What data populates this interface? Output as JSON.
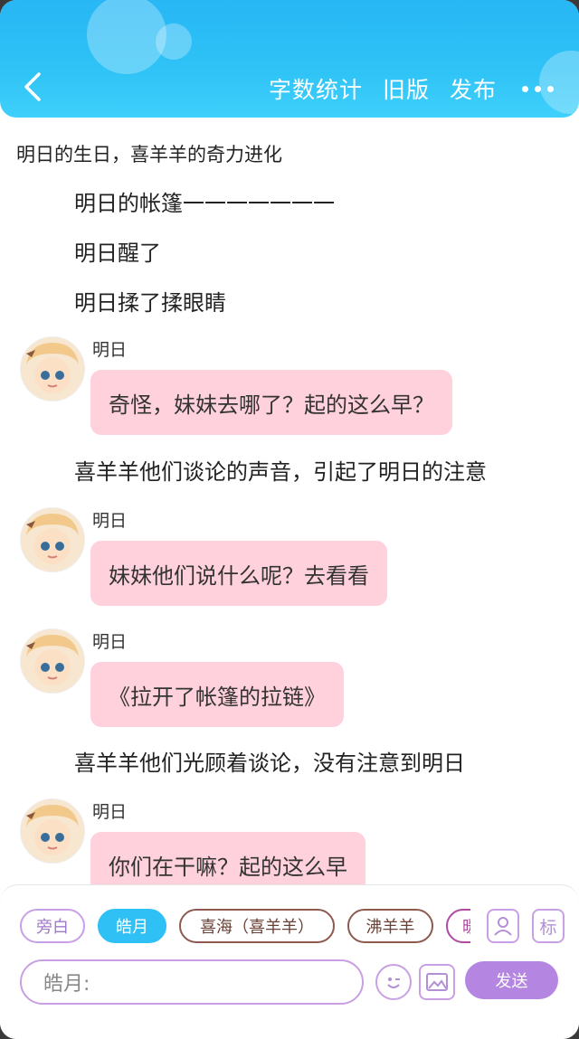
{
  "header": {
    "actions": [
      "字数统计",
      "旧版",
      "发布"
    ]
  },
  "story": {
    "title": "明日的生日，喜羊羊的奇力进化",
    "narrations": [
      "明日的帐篷一一一一一一一",
      "明日醒了",
      "明日揉了揉眼睛",
      "喜羊羊他们谈论的声音，引起了明日的注意",
      "喜羊羊他们光顾着谈论，没有注意到明日"
    ],
    "messages": [
      {
        "speaker": "明日",
        "text": "奇怪，妹妹去哪了？起的这么早？"
      },
      {
        "speaker": "明日",
        "text": "妹妹他们说什么呢？去看看"
      },
      {
        "speaker": "明日",
        "text": "《拉开了帐篷的拉链》"
      },
      {
        "speaker": "明日",
        "text": "你们在干嘛？起的这么早"
      }
    ]
  },
  "composer": {
    "chips": [
      "旁白",
      "皓月",
      "喜海（喜羊羊）",
      "沸羊羊",
      "暖"
    ],
    "active_chip": "皓月",
    "icon_person": "person-icon",
    "icon_mark_label": "标",
    "input_placeholder": "皓月:",
    "send_label": "发送"
  },
  "colors": {
    "header": "#2fc0f5",
    "bubble": "#ffd1dc",
    "accent_purple": "#b486e2"
  }
}
